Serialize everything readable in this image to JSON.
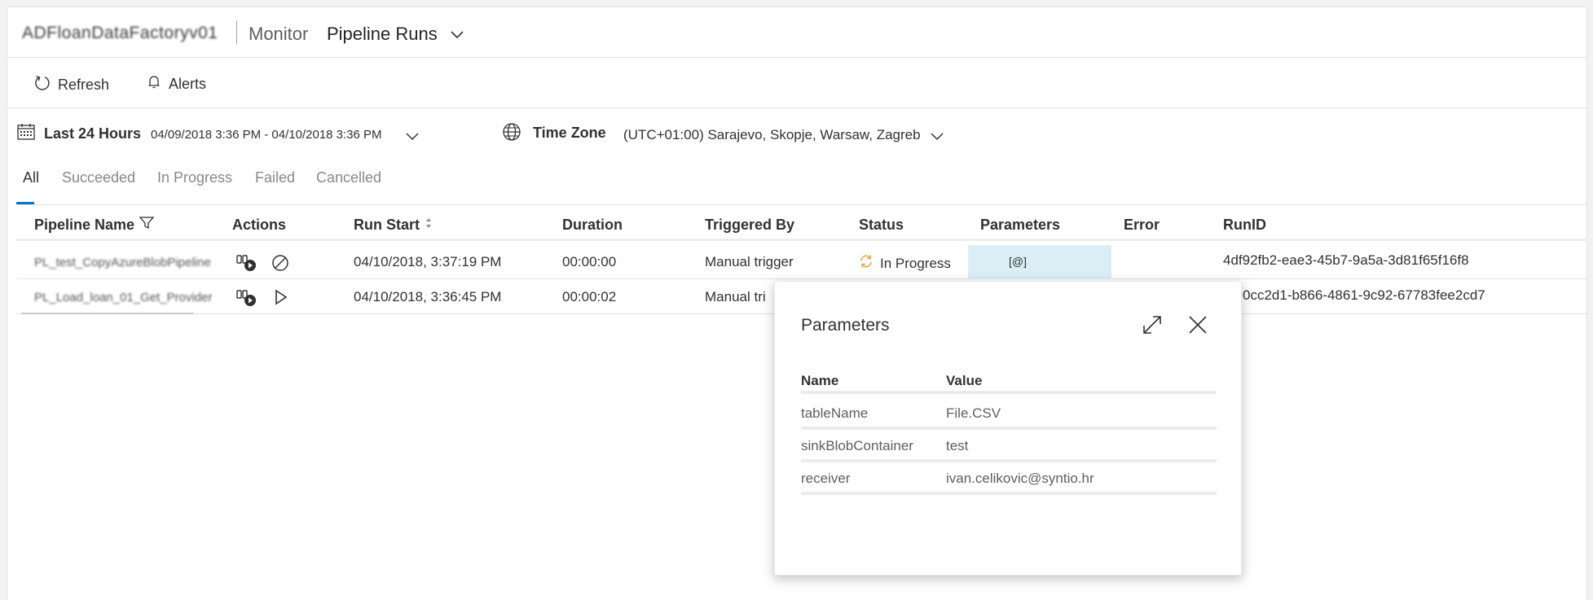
{
  "header": {
    "factory_name": "ADFloanDataFactoryv01",
    "section": "Monitor",
    "view": "Pipeline Runs"
  },
  "toolbar": {
    "refresh_label": "Refresh",
    "alerts_label": "Alerts"
  },
  "filter": {
    "range_label": "Last 24 Hours",
    "range_dates": "04/09/2018 3:36 PM - 04/10/2018 3:36 PM",
    "timezone_label": "Time Zone",
    "timezone_value": "(UTC+01:00) Sarajevo, Skopje, Warsaw, Zagreb"
  },
  "tabs": [
    "All",
    "Succeeded",
    "In Progress",
    "Failed",
    "Cancelled"
  ],
  "table": {
    "headers": {
      "pipeline_name": "Pipeline Name",
      "actions": "Actions",
      "run_start": "Run Start",
      "duration": "Duration",
      "triggered_by": "Triggered By",
      "status": "Status",
      "parameters": "Parameters",
      "error": "Error",
      "run_id": "RunID"
    },
    "rows": [
      {
        "pipeline_name": "PL_test_CopyAzureBlobPipeline",
        "run_start": "04/10/2018, 3:37:19 PM",
        "duration": "00:00:00",
        "triggered_by": "Manual trigger",
        "status": "In Progress",
        "parameters": "[@]",
        "error": "",
        "run_id": "4df92fb2-eae3-45b7-9a5a-3d81f65f16f8"
      },
      {
        "pipeline_name": "PL_Load_loan_01_Get_Provider",
        "run_start": "04/10/2018, 3:36:45 PM",
        "duration": "00:00:02",
        "triggered_by": "Manual tri",
        "status": "",
        "parameters": "",
        "error": "",
        "run_id": "0cc2d1-b866-4861-9c92-67783fee2cd7"
      }
    ]
  },
  "panel": {
    "title": "Parameters",
    "col_name": "Name",
    "col_value": "Value",
    "rows": [
      {
        "name": "tableName",
        "value": "File.CSV"
      },
      {
        "name": "sinkBlobContainer",
        "value": "test"
      },
      {
        "name": "receiver",
        "value": "ivan.celikovic@syntio.hr"
      }
    ]
  },
  "colors": {
    "accent": "#0078d4",
    "in_progress_icon": "#e8a33b",
    "selected_cell": "#dceef5"
  }
}
